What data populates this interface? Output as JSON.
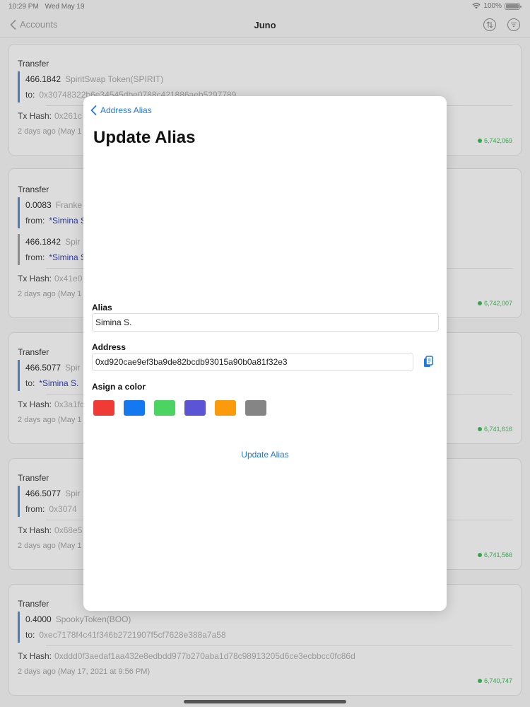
{
  "status_bar": {
    "time": "10:29 PM",
    "date": "Wed May 19",
    "battery": "100%"
  },
  "nav": {
    "back_label": "Accounts",
    "title": "Juno"
  },
  "transactions": [
    {
      "type": "Transfer",
      "legs": [
        {
          "amount": "466.1842",
          "token": "SpiritSwap Token(SPIRIT)",
          "dir_label": "to:",
          "address": "0x30748322b6e34545dbe0788c421886aeb5297789"
        }
      ],
      "hash_label": "Tx Hash:",
      "hash": "0x261c",
      "time": "2 days ago (May 1",
      "block": "6,742,069"
    },
    {
      "type": "Transfer",
      "legs": [
        {
          "amount": "0.0083",
          "token": "Franke",
          "dir_label": "from:",
          "alias": "*Simina S"
        },
        {
          "amount": "466.1842",
          "token": "Spir",
          "dir_label": "from:",
          "alias": "*Simina S"
        }
      ],
      "hash_label": "Tx Hash:",
      "hash": "0x41e0",
      "time": "2 days ago (May 1",
      "block": "6,742,007"
    },
    {
      "type": "Transfer",
      "legs": [
        {
          "amount": "466.5077",
          "token": "Spir",
          "dir_label": "to:",
          "alias": "*Simina S."
        }
      ],
      "hash_label": "Tx Hash:",
      "hash": "0x3a1fc",
      "time": "2 days ago (May 1",
      "block": "6,741,616"
    },
    {
      "type": "Transfer",
      "legs": [
        {
          "amount": "466.5077",
          "token": "Spir",
          "dir_label": "from:",
          "address": "0x3074"
        }
      ],
      "hash_label": "Tx Hash:",
      "hash": "0x68e5",
      "time": "2 days ago (May 1",
      "block": "6,741,566"
    },
    {
      "type": "Transfer",
      "legs": [
        {
          "amount": "0.4000",
          "token": "SpookyToken(BOO)",
          "dir_label": "to:",
          "address": "0xec7178f4c41f346b2721907f5cf7628e388a7a58"
        }
      ],
      "hash_label": "Tx Hash:",
      "hash": "0xddd0f3aedaf1aa432e8edbdd977b270aba1d78c98913205d6ce3ecbbcc0fc86d",
      "time": "2 days ago (May 17, 2021 at 9:56 PM)",
      "block": "6,740,747"
    }
  ],
  "modal": {
    "back_label": "Address Alias",
    "title": "Update Alias",
    "alias_label": "Alias",
    "alias_value": "Simina S.",
    "address_label": "Address",
    "address_value": "0xd920cae9ef3ba9de82bcdb93015a90b0a81f32e3",
    "color_label": "Asign a color",
    "colors": [
      {
        "name": "red",
        "hex": "#F03A35"
      },
      {
        "name": "blue",
        "hex": "#1479F0"
      },
      {
        "name": "green",
        "hex": "#4CD463"
      },
      {
        "name": "indigo",
        "hex": "#5B55D6"
      },
      {
        "name": "orange",
        "hex": "#FB9A0B"
      },
      {
        "name": "gray",
        "hex": "#858585"
      }
    ],
    "update_label": "Update Alias"
  }
}
